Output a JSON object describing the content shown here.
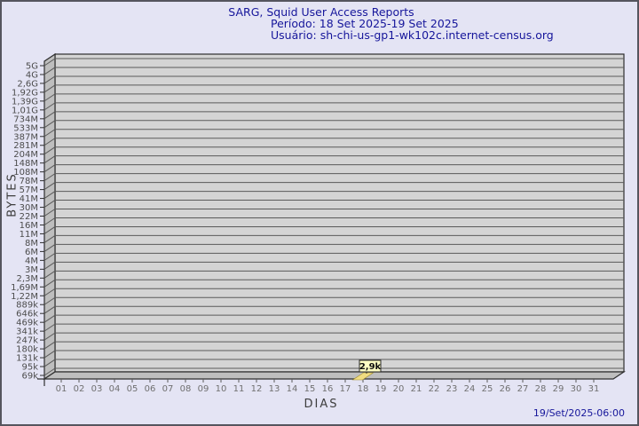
{
  "header": {
    "title": "SARG, Squid User Access Reports",
    "period": "Período: 18 Set 2025-19 Set 2025",
    "user": "Usuário: sh-chi-us-gp1-wk102c.internet-census.org"
  },
  "footer": {
    "timestamp": "19/Set/2025-06:00"
  },
  "chart_data": {
    "type": "bar",
    "title": "SARG, Squid User Access Reports",
    "subtitle": "Período: 18 Set 2025-19 Set 2025",
    "user_line": "Usuário: sh-chi-us-gp1-wk102c.internet-census.org",
    "xlabel": "DIAS",
    "ylabel": "BYTES",
    "x_ticks": [
      "01",
      "02",
      "03",
      "04",
      "05",
      "06",
      "07",
      "08",
      "09",
      "10",
      "11",
      "12",
      "13",
      "14",
      "15",
      "16",
      "17",
      "18",
      "19",
      "20",
      "21",
      "22",
      "23",
      "24",
      "25",
      "26",
      "27",
      "28",
      "29",
      "30",
      "31"
    ],
    "y_ticks_top_to_bottom": [
      "5G",
      "4G",
      "2,6G",
      "1,92G",
      "1,39G",
      "1,01G",
      "734M",
      "533M",
      "387M",
      "281M",
      "204M",
      "148M",
      "108M",
      "78M",
      "57M",
      "41M",
      "30M",
      "22M",
      "16M",
      "11M",
      "8M",
      "6M",
      "4M",
      "3M",
      "2,3M",
      "1,69M",
      "1,22M",
      "889k",
      "646k",
      "469k",
      "341k",
      "247k",
      "180k",
      "131k",
      "95k",
      "69k"
    ],
    "grid": true,
    "legend": "none",
    "style": "3d-bar",
    "bars": [
      {
        "x": "18",
        "label": "2,9k",
        "value_bytes": 2900
      }
    ],
    "colors": {
      "background": "#e4e4f4",
      "title_text": "#16169b",
      "plot_back": "#d4d4d4",
      "plot_wall": "#bebebe",
      "gridline": "#5a5a5a",
      "box_border": "#2e2e2e",
      "y_tick_text": "#4c4c4c",
      "x_tick_text": "#707070",
      "bar_fill": "#f0dc82",
      "bar_edge": "#a08c2a",
      "value_box_fill": "#ffffc4",
      "value_box_border": "#2a2a2a",
      "value_text": "#111111",
      "timestamp_text": "#16169b"
    }
  }
}
